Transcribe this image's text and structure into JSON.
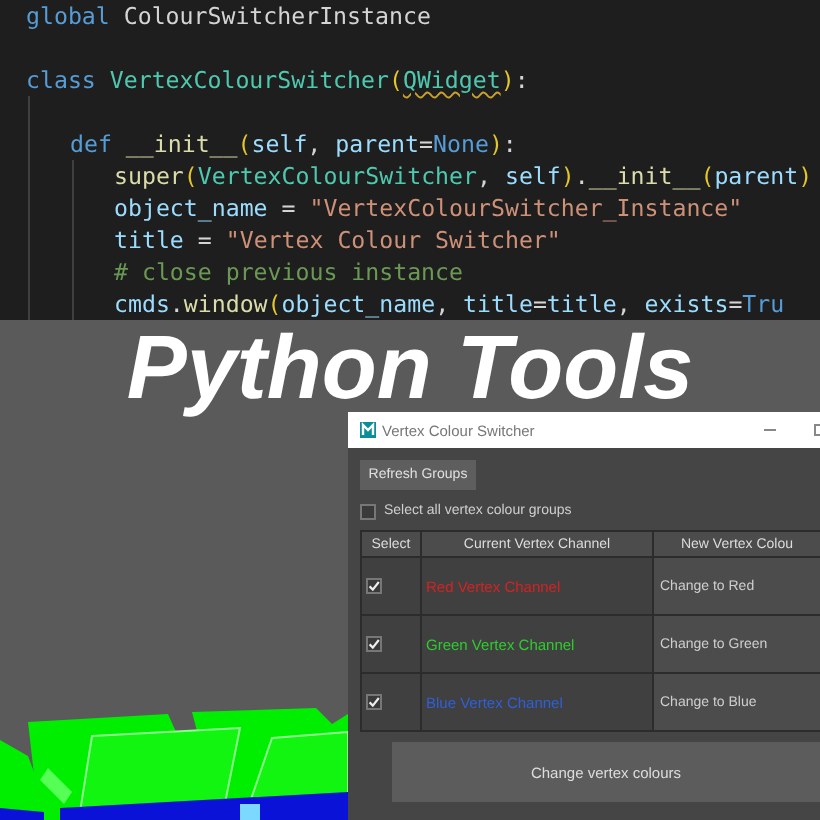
{
  "editor": {
    "lines": [
      {
        "tokens": [
          {
            "kind": "kw",
            "text": "global"
          },
          {
            "kind": "plain",
            "text": "ColourSwitcherInstance",
            "space_before": true
          }
        ]
      },
      {
        "gap_before": true,
        "tokens": [
          {
            "kind": "kw",
            "text": "class"
          },
          {
            "kind": "cls",
            "text": "VertexColourSwitcher",
            "space_before": true
          },
          {
            "kind": "paren",
            "text": "("
          },
          {
            "kind": "cls",
            "text": "QWidget",
            "warning": true
          },
          {
            "kind": "paren",
            "text": ")"
          },
          {
            "kind": "plain",
            "text": ":"
          }
        ],
        "children": [
          {
            "gap_before": true,
            "tokens": [
              {
                "kind": "kw",
                "text": "def"
              },
              {
                "kind": "fn",
                "text": "__init__",
                "space_before": true
              },
              {
                "kind": "paren",
                "text": "("
              },
              {
                "kind": "var",
                "text": "self"
              },
              {
                "kind": "plain",
                "text": ", "
              },
              {
                "kind": "var",
                "text": "parent"
              },
              {
                "kind": "plain",
                "text": "="
              },
              {
                "kind": "kw",
                "text": "None"
              },
              {
                "kind": "paren",
                "text": ")"
              },
              {
                "kind": "plain",
                "text": ":"
              }
            ],
            "children": [
              {
                "tokens": [
                  {
                    "kind": "fn",
                    "text": "super"
                  },
                  {
                    "kind": "paren",
                    "text": "("
                  },
                  {
                    "kind": "cls",
                    "text": "VertexColourSwitcher"
                  },
                  {
                    "kind": "plain",
                    "text": ", "
                  },
                  {
                    "kind": "var",
                    "text": "self"
                  },
                  {
                    "kind": "paren",
                    "text": ")"
                  },
                  {
                    "kind": "plain",
                    "text": "."
                  },
                  {
                    "kind": "fn",
                    "text": "__init__"
                  },
                  {
                    "kind": "paren",
                    "text": "("
                  },
                  {
                    "kind": "var",
                    "text": "parent"
                  },
                  {
                    "kind": "paren",
                    "text": ")"
                  }
                ]
              },
              {
                "tokens": [
                  {
                    "kind": "var",
                    "text": "object_name"
                  },
                  {
                    "kind": "plain",
                    "text": " = "
                  },
                  {
                    "kind": "str",
                    "text": "\"VertexColourSwitcher_Instance\""
                  }
                ]
              },
              {
                "tokens": [
                  {
                    "kind": "var",
                    "text": "title"
                  },
                  {
                    "kind": "plain",
                    "text": " = "
                  },
                  {
                    "kind": "str",
                    "text": "\"Vertex Colour Switcher\""
                  }
                ]
              },
              {
                "tokens": [
                  {
                    "kind": "cmt",
                    "text": "# close previous instance"
                  }
                ]
              },
              {
                "tokens": [
                  {
                    "kind": "var",
                    "text": "cmds"
                  },
                  {
                    "kind": "plain",
                    "text": "."
                  },
                  {
                    "kind": "fn",
                    "text": "window"
                  },
                  {
                    "kind": "paren",
                    "text": "("
                  },
                  {
                    "kind": "var",
                    "text": "object_name"
                  },
                  {
                    "kind": "plain",
                    "text": ", "
                  },
                  {
                    "kind": "var",
                    "text": "title"
                  },
                  {
                    "kind": "plain",
                    "text": "="
                  },
                  {
                    "kind": "var",
                    "text": "title"
                  },
                  {
                    "kind": "plain",
                    "text": ", "
                  },
                  {
                    "kind": "var",
                    "text": "exists"
                  },
                  {
                    "kind": "plain",
                    "text": "="
                  },
                  {
                    "kind": "kw",
                    "text": "Tru"
                  }
                ]
              }
            ]
          }
        ]
      }
    ]
  },
  "banner": {
    "title": "Python Tools"
  },
  "dialog": {
    "title": "Vertex Colour Switcher",
    "refresh_button": "Refresh Groups",
    "select_all": {
      "label": "Select all vertex colour groups",
      "checked": false
    },
    "table": {
      "columns": [
        "Select",
        "Current Vertex Channel",
        "New Vertex Colou"
      ],
      "rows": [
        {
          "checked": true,
          "channel": "Red Vertex Channel",
          "color": "#d42222",
          "action": "Change to Red"
        },
        {
          "checked": true,
          "channel": "Green Vertex Channel",
          "color": "#2ecc2e",
          "action": "Change to Green"
        },
        {
          "checked": true,
          "channel": "Blue Vertex Channel",
          "color": "#2f5fd8",
          "action": "Change to Blue"
        }
      ]
    },
    "apply_button": "Change vertex colours"
  }
}
